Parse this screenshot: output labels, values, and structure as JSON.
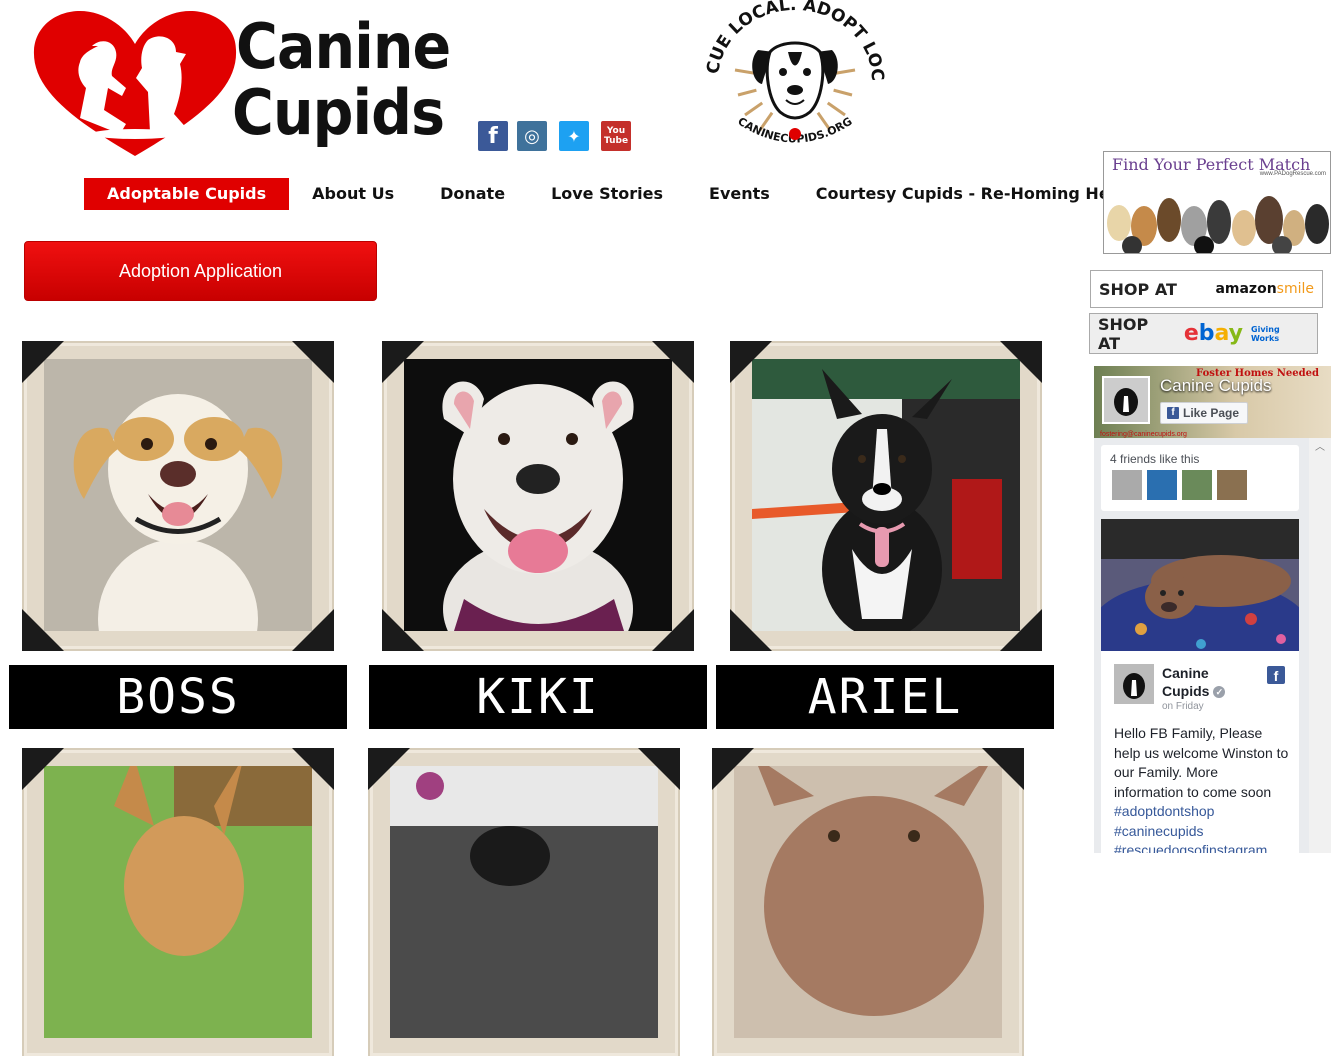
{
  "brand": {
    "line1": "Canine",
    "line2": "Cupids",
    "badge_top": "RESCUE LOCAL. ADOPT LOCAL.",
    "badge_bottom": "CANINECUPIDS.ORG",
    "colors": {
      "red": "#e00000",
      "dark": "#111111"
    }
  },
  "social": [
    {
      "icon": "facebook-icon",
      "glyph": "f",
      "color": "#3b5998"
    },
    {
      "icon": "instagram-icon",
      "glyph": "◎",
      "color": "#3f729b"
    },
    {
      "icon": "twitter-icon",
      "glyph": "🐦",
      "color": "#1da1f2"
    },
    {
      "icon": "youtube-icon",
      "glyph": "You Tube",
      "color": "#c4302b"
    }
  ],
  "nav": {
    "items": [
      {
        "label": "Adoptable Cupids",
        "active": true
      },
      {
        "label": "About Us"
      },
      {
        "label": "Donate"
      },
      {
        "label": "Love Stories"
      },
      {
        "label": "Events"
      },
      {
        "label": "Courtesy Cupids - Re-Homing Help"
      }
    ]
  },
  "main": {
    "apply_label": "Adoption Application",
    "dogs": [
      {
        "name": "BOSS"
      },
      {
        "name": "KIKI"
      },
      {
        "name": "ARIEL"
      }
    ]
  },
  "sidebar": {
    "find_match": {
      "title": "Find Your Perfect Match",
      "url": "www.PADogRescue.com"
    },
    "shop_amazon": {
      "prefix": "SHOP AT",
      "brand": "amazon",
      "suffix": "smile"
    },
    "shop_ebay": {
      "prefix": "SHOP AT",
      "brand": "ebay",
      "suffix": "Giving Works"
    },
    "facebook": {
      "page_name": "Canine Cupids",
      "like_label": "Like Page",
      "cover_text": "Foster Homes Needed",
      "cover_email": "fostering@caninecupids.org",
      "friends_text": "4 friends like this",
      "post": {
        "author_line1": "Canine",
        "author_line2": "Cupids",
        "time": "on Friday",
        "text": "Hello FB Family, Please help us welcome Winston to our Family. More information to come soon",
        "tags": [
          "#adoptdontshop",
          "#caninecupids",
          "#rescuedogsofinstagram"
        ]
      }
    }
  }
}
